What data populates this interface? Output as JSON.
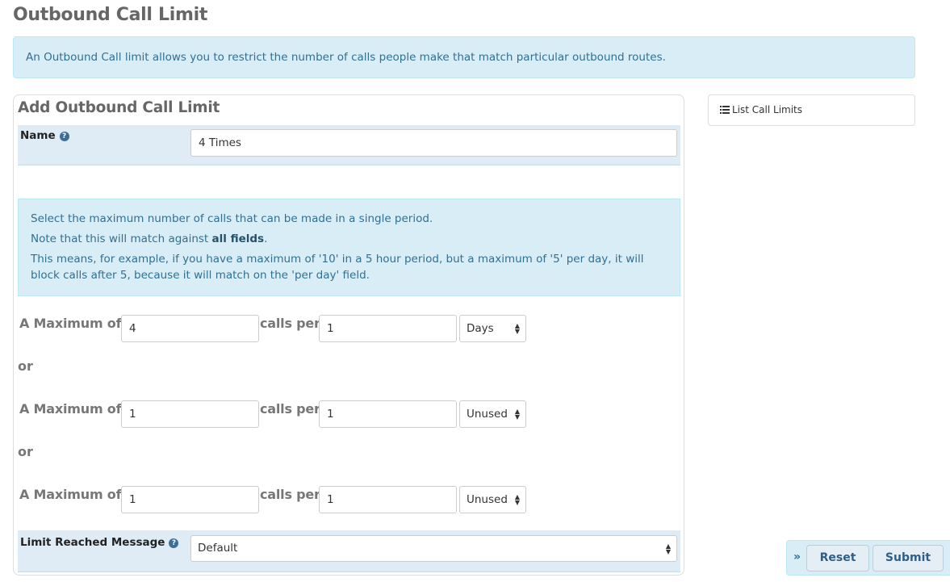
{
  "page": {
    "title": "Outbound Call Limit",
    "intro": "An Outbound Call limit allows you to restrict the number of calls people make that match particular outbound routes."
  },
  "form": {
    "title": "Add Outbound Call Limit",
    "name": {
      "label": "Name",
      "value": "4 Times",
      "help_icon": "question-circle-icon"
    },
    "note": {
      "line1": "Select the maximum number of calls that can be made in a single period.",
      "line2_prefix": "Note that this will match against ",
      "line2_bold": "all fields",
      "line2_suffix": ".",
      "line3": "This means, for example, if you have a maximum of '10' in a 5 hour period, but a maximum of '5' per day, it will block calls after 5, because it will match on the 'per day' field."
    },
    "limits": [
      {
        "max_label": "A Maximum of",
        "count": "4",
        "per_label": "calls per",
        "period": "1",
        "unit": "Days"
      },
      {
        "max_label": "A Maximum of",
        "count": "1",
        "per_label": "calls per",
        "period": "1",
        "unit": "Unused"
      },
      {
        "max_label": "A Maximum of",
        "count": "1",
        "per_label": "calls per",
        "period": "1",
        "unit": "Unused"
      }
    ],
    "or_label": "or",
    "message": {
      "label": "Limit Reached Message",
      "value": "Default",
      "help_icon": "question-circle-icon"
    }
  },
  "sidebar": {
    "list_link": "List Call Limits",
    "list_icon": "list-icon"
  },
  "actions": {
    "collapse_icon": "double-chevron-right-icon",
    "reset": "Reset",
    "submit": "Submit"
  },
  "colors": {
    "alert_bg": "#d9edf7",
    "alert_text": "#31708f",
    "field_row_bg": "#dfecf5",
    "heading": "#666666"
  }
}
